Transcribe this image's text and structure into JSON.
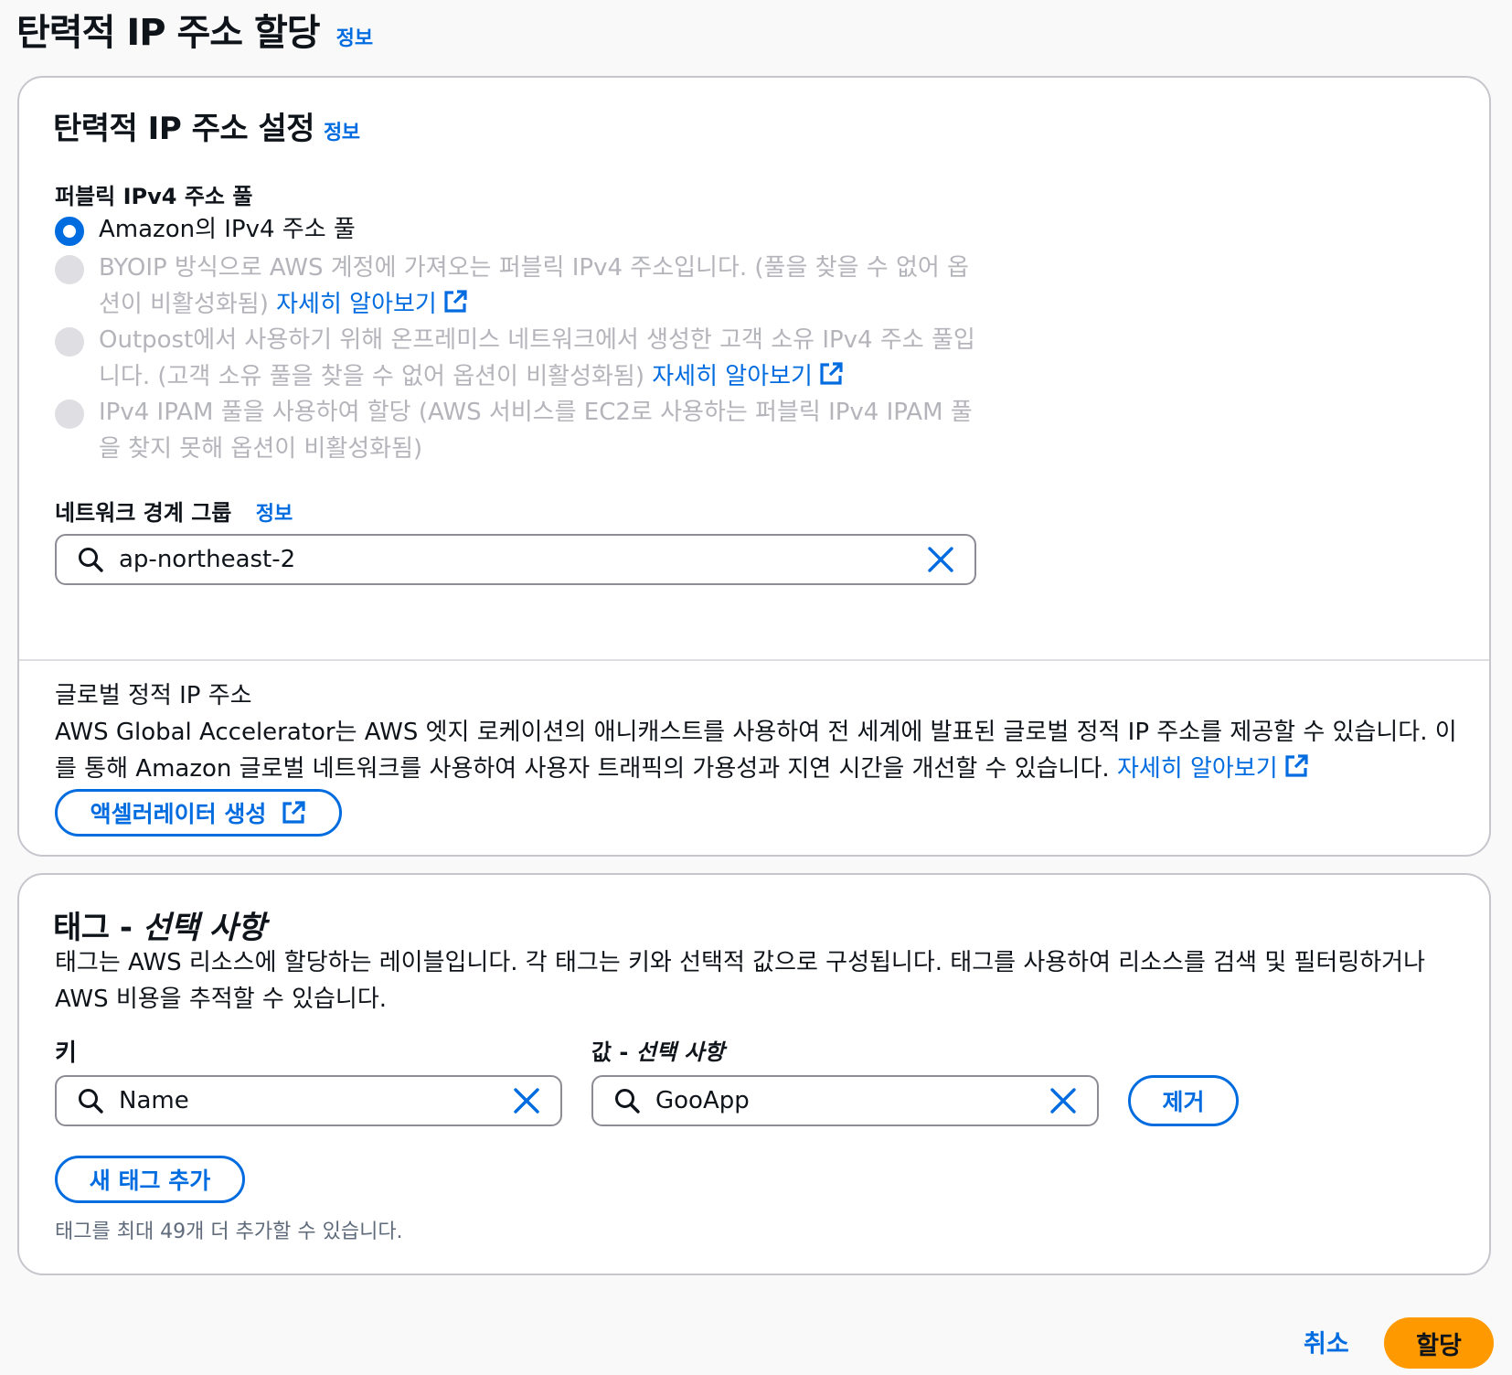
{
  "page": {
    "title": "탄력적 IP 주소 할당",
    "info": "정보"
  },
  "settings": {
    "title": "탄력적 IP 주소 설정",
    "info": "정보",
    "pool_label": "퍼블릭 IPv4 주소 풀",
    "options": [
      {
        "text": "Amazon의 IPv4 주소 풀",
        "selected": true,
        "disabled": false
      },
      {
        "text": "BYOIP 방식으로 AWS 계정에 가져오는 퍼블릭 IPv4 주소입니다. (풀을 찾을 수 없어 옵션이 비활성화됨)",
        "link": "자세히 알아보기",
        "selected": false,
        "disabled": true
      },
      {
        "text": "Outpost에서 사용하기 위해 온프레미스 네트워크에서 생성한 고객 소유 IPv4 주소 풀입니다. (고객 소유 풀을 찾을 수 없어 옵션이 비활성화됨)",
        "link": "자세히 알아보기",
        "selected": false,
        "disabled": true
      },
      {
        "text": "IPv4 IPAM 풀을 사용하여 할당 (AWS 서비스를 EC2로 사용하는 퍼블릭 IPv4 IPAM 풀을 찾지 못해 옵션이 비활성화됨)",
        "selected": false,
        "disabled": true
      }
    ],
    "border_group_label": "네트워크 경계 그룹",
    "border_group_info": "정보",
    "border_group_value": "ap-northeast-2",
    "global_title": "글로벌 정적 IP 주소",
    "global_desc": "AWS Global Accelerator는 AWS 엣지 로케이션의 애니캐스트를 사용하여 전 세계에 발표된 글로벌 정적 IP 주소를 제공할 수 있습니다. 이를 통해 Amazon 글로벌 네트워크를 사용하여 사용자 트래픽의 가용성과 지연 시간을 개선할 수 있습니다.",
    "global_link": "자세히 알아보기",
    "create_accelerator": "액셀러레이터 생성"
  },
  "tags": {
    "title_main": "태그 - ",
    "title_optional": "선택 사항",
    "desc": "태그는 AWS 리소스에 할당하는 레이블입니다. 각 태그는 키와 선택적 값으로 구성됩니다. 태그를 사용하여 리소스를 검색 및 필터링하거나 AWS 비용을 추적할 수 있습니다.",
    "key_label": "키",
    "value_label_main": "값 - ",
    "value_label_optional": "선택 사항",
    "key_value": "Name",
    "value_value": "GooApp",
    "remove": "제거",
    "add_tag": "새 태그 추가",
    "hint": "태그를 최대 49개 더 추가할 수 있습니다."
  },
  "footer": {
    "cancel": "취소",
    "allocate": "할당"
  },
  "colors": {
    "accent": "#006ce0",
    "primary_button": "#ff9900"
  }
}
